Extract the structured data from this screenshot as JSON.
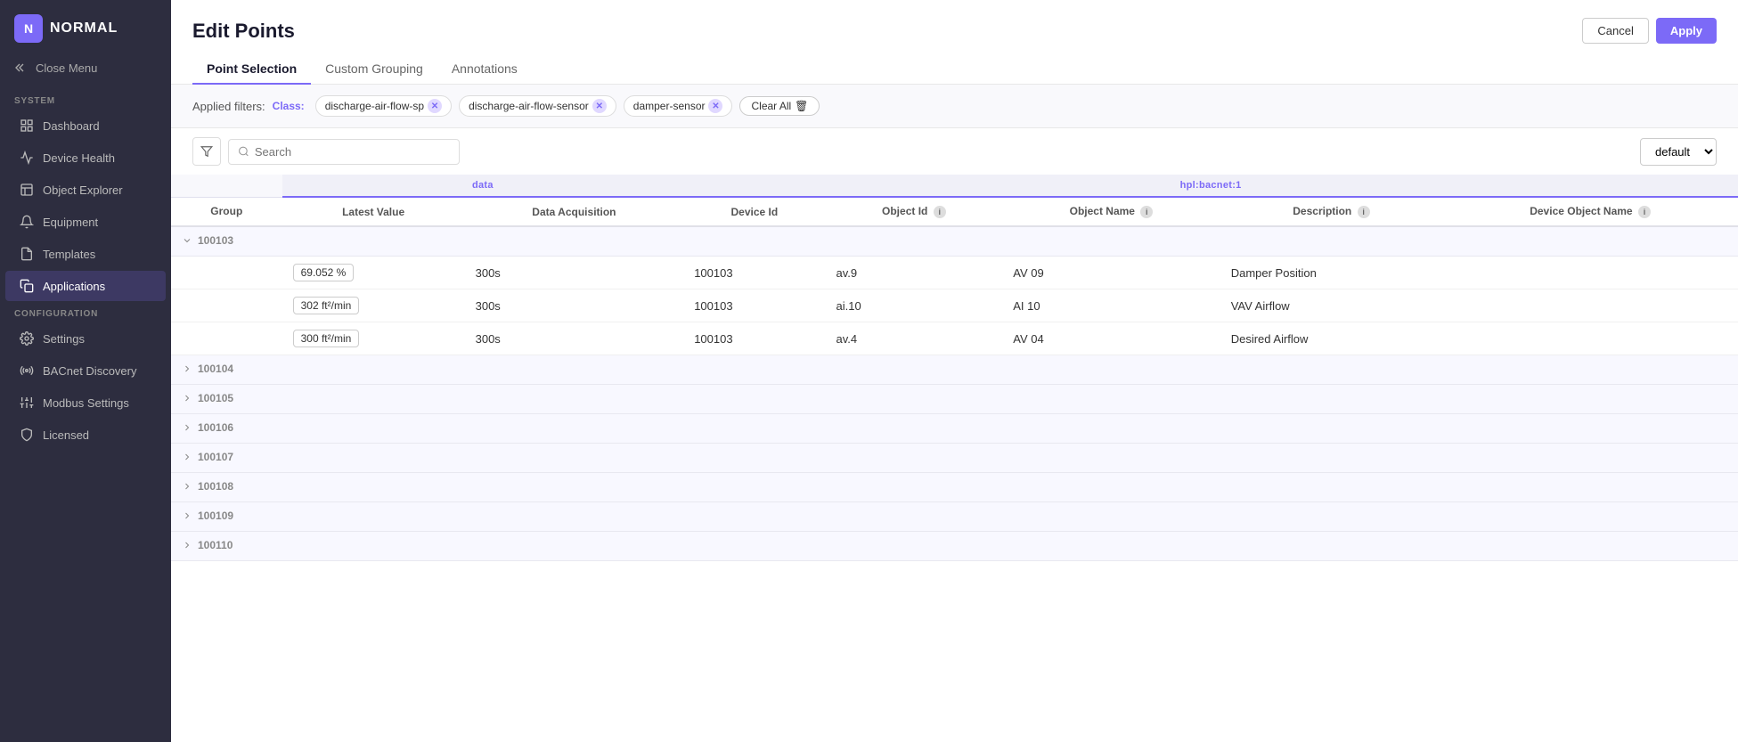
{
  "sidebar": {
    "logo_text": "NORMAL",
    "close_menu_label": "Close Menu",
    "system_label": "SYSTEM",
    "configuration_label": "CONFIGURATION",
    "items_system": [
      {
        "id": "dashboard",
        "label": "Dashboard",
        "icon": "grid"
      },
      {
        "id": "device-health",
        "label": "Device Health",
        "icon": "activity"
      },
      {
        "id": "object-explorer",
        "label": "Object Explorer",
        "icon": "layout"
      },
      {
        "id": "equipment",
        "label": "Equipment",
        "icon": "bell"
      },
      {
        "id": "templates",
        "label": "Templates",
        "icon": "file"
      },
      {
        "id": "applications",
        "label": "Applications",
        "icon": "copy",
        "active": true
      }
    ],
    "items_config": [
      {
        "id": "settings",
        "label": "Settings",
        "icon": "gear"
      },
      {
        "id": "bacnet-discovery",
        "label": "BACnet Discovery",
        "icon": "radio"
      },
      {
        "id": "modbus-settings",
        "label": "Modbus Settings",
        "icon": "sliders"
      },
      {
        "id": "licensed",
        "label": "Licensed",
        "icon": "shield"
      }
    ]
  },
  "header": {
    "title": "Edit Points",
    "cancel_label": "Cancel",
    "apply_label": "Apply",
    "tabs": [
      {
        "id": "point-selection",
        "label": "Point Selection",
        "active": true
      },
      {
        "id": "custom-grouping",
        "label": "Custom Grouping"
      },
      {
        "id": "annotations",
        "label": "Annotations"
      }
    ]
  },
  "filters": {
    "label": "Applied filters:",
    "class_label": "Class:",
    "chips": [
      {
        "id": "chip1",
        "value": "discharge-air-flow-sp"
      },
      {
        "id": "chip2",
        "value": "discharge-air-flow-sensor"
      },
      {
        "id": "chip3",
        "value": "damper-sensor"
      }
    ],
    "clear_all_label": "Clear All"
  },
  "toolbar": {
    "search_placeholder": "Search",
    "default_select": "default"
  },
  "table": {
    "col_sources": [
      {
        "label": "",
        "colspan": 1
      },
      {
        "label": "data",
        "colspan": 2
      },
      {
        "label": "hpl:bacnet:1",
        "colspan": 5
      }
    ],
    "columns": [
      {
        "id": "group",
        "label": "Group"
      },
      {
        "id": "latest-value",
        "label": "Latest Value"
      },
      {
        "id": "data-acquisition",
        "label": "Data Acquisition"
      },
      {
        "id": "device-id",
        "label": "Device Id"
      },
      {
        "id": "object-id",
        "label": "Object Id",
        "info": true
      },
      {
        "id": "object-name",
        "label": "Object Name",
        "info": true
      },
      {
        "id": "description",
        "label": "Description",
        "info": true
      },
      {
        "id": "device-object-name",
        "label": "Device Object Name",
        "info": true
      }
    ],
    "groups": [
      {
        "id": "100103",
        "expanded": true,
        "rows": [
          {
            "latest_value": "69.052 %",
            "data_acquisition": "300s",
            "device_id": "100103",
            "object_id": "av.9",
            "object_name": "AV 09",
            "description": "Damper Position",
            "device_object_name": ""
          },
          {
            "latest_value": "302 ft²/min",
            "data_acquisition": "300s",
            "device_id": "100103",
            "object_id": "ai.10",
            "object_name": "AI 10",
            "description": "VAV Airflow",
            "device_object_name": ""
          },
          {
            "latest_value": "300 ft²/min",
            "data_acquisition": "300s",
            "device_id": "100103",
            "object_id": "av.4",
            "object_name": "AV 04",
            "description": "Desired Airflow",
            "device_object_name": ""
          }
        ]
      },
      {
        "id": "100104",
        "expanded": false,
        "rows": []
      },
      {
        "id": "100105",
        "expanded": false,
        "rows": []
      },
      {
        "id": "100106",
        "expanded": false,
        "rows": []
      },
      {
        "id": "100107",
        "expanded": false,
        "rows": []
      },
      {
        "id": "100108",
        "expanded": false,
        "rows": []
      },
      {
        "id": "100109",
        "expanded": false,
        "rows": []
      },
      {
        "id": "100110",
        "expanded": false,
        "rows": []
      }
    ]
  }
}
